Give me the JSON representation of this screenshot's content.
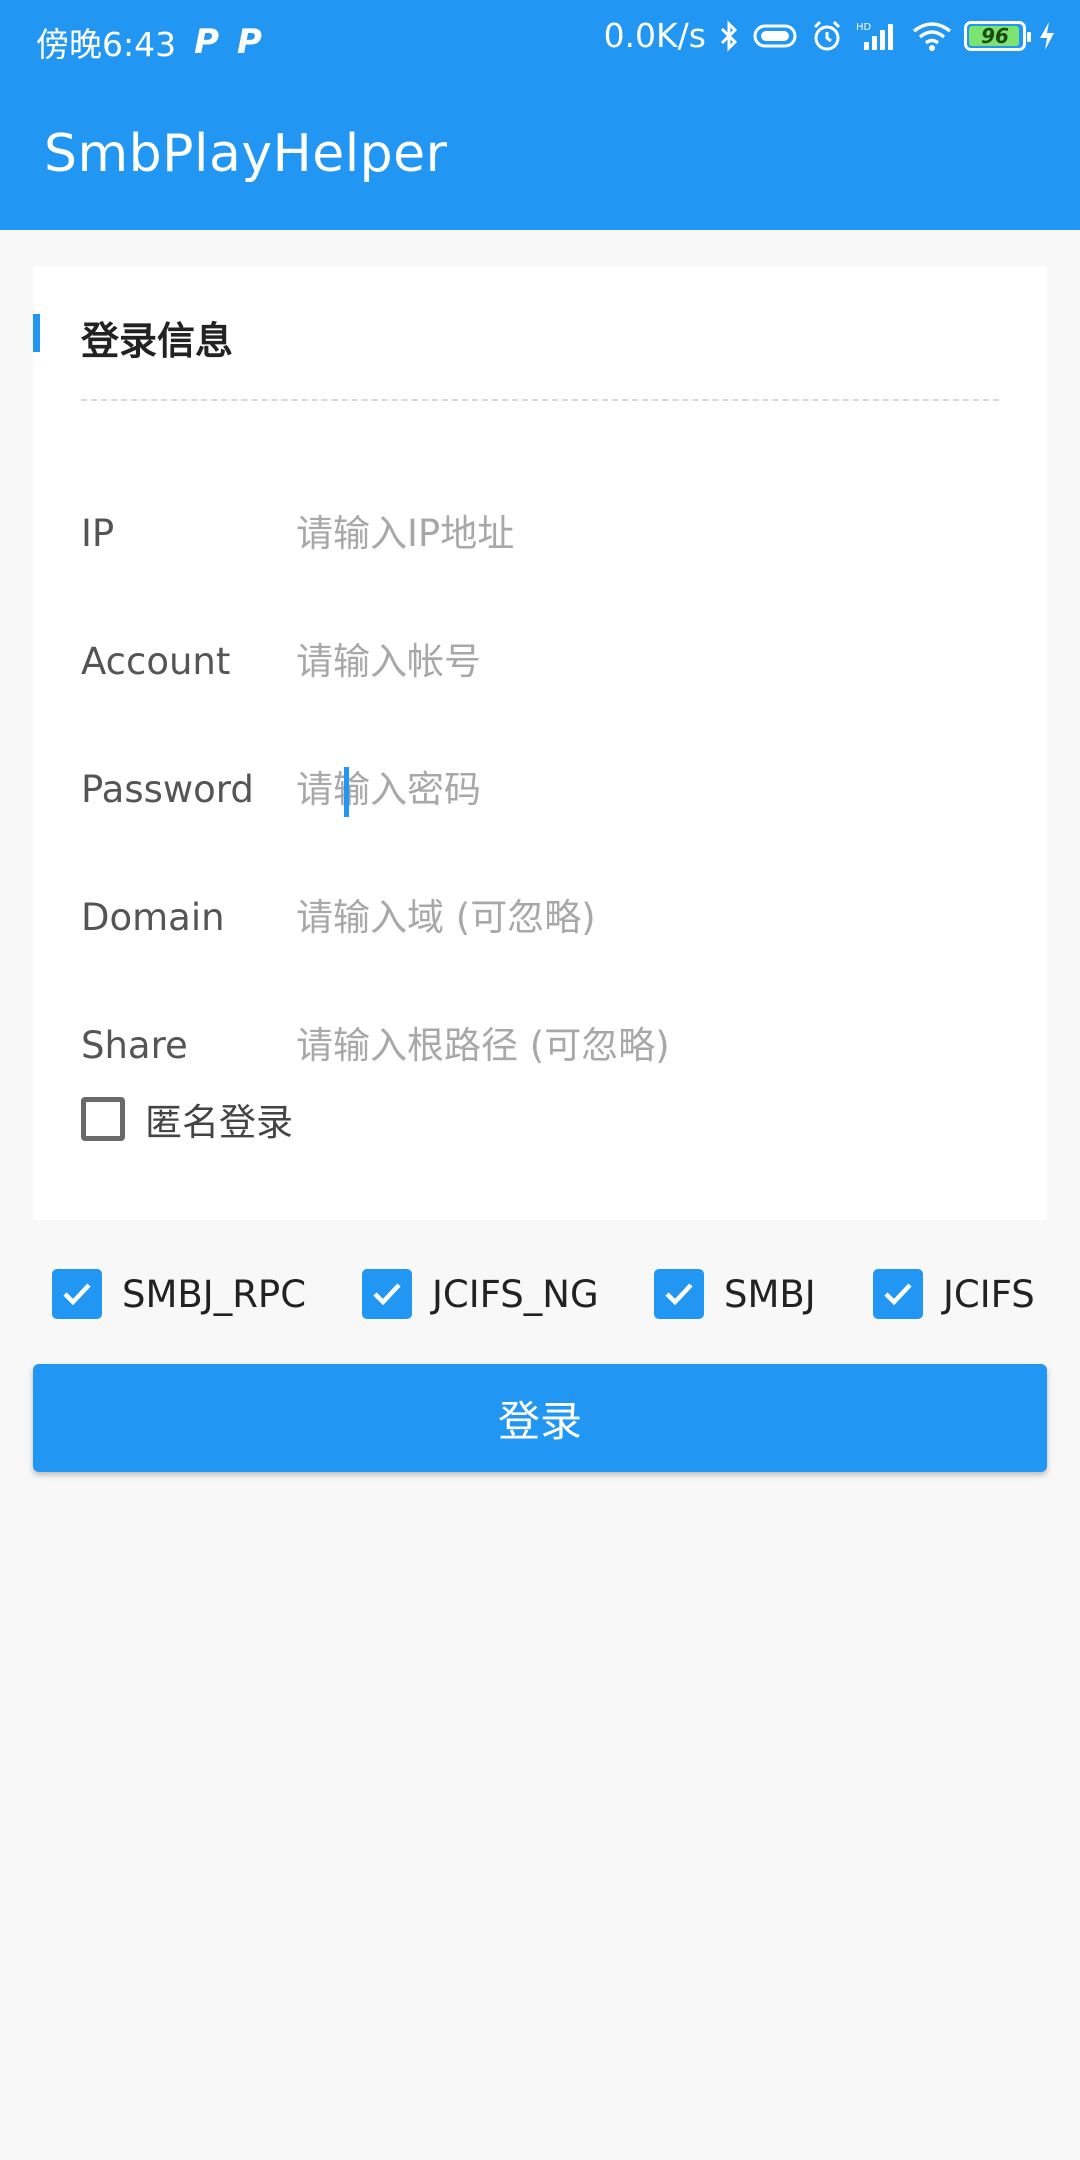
{
  "status_bar": {
    "time": "傍晚6:43",
    "left_icons": [
      "P",
      "P"
    ],
    "network_speed": "0.0K/s",
    "battery": "96",
    "icons": [
      "bluetooth-icon",
      "vibrate-icon",
      "alarm-icon",
      "signal-icon",
      "wifi-icon",
      "battery-icon",
      "charging-icon"
    ]
  },
  "app_bar": {
    "title": "SmbPlayHelper",
    "color": "#2196f3"
  },
  "form": {
    "section_title": "登录信息",
    "fields": [
      {
        "label": "IP",
        "placeholder": "请输入IP地址",
        "value": ""
      },
      {
        "label": "Account",
        "placeholder": "请输入帐号",
        "value": ""
      },
      {
        "label": "Password",
        "placeholder": "请输入密码",
        "value": ""
      },
      {
        "label": "Domain",
        "placeholder": "请输入域 (可忽略)",
        "value": ""
      },
      {
        "label": "Share",
        "placeholder": "请输入根路径 (可忽略)",
        "value": ""
      }
    ],
    "anonymous": {
      "label": "匿名登录",
      "checked": false
    }
  },
  "protocols": [
    {
      "label": "SMBJ_RPC",
      "checked": true
    },
    {
      "label": "JCIFS_NG",
      "checked": true
    },
    {
      "label": "SMBJ",
      "checked": true
    },
    {
      "label": "JCIFS",
      "checked": true
    }
  ],
  "login_button": {
    "label": "登录"
  }
}
